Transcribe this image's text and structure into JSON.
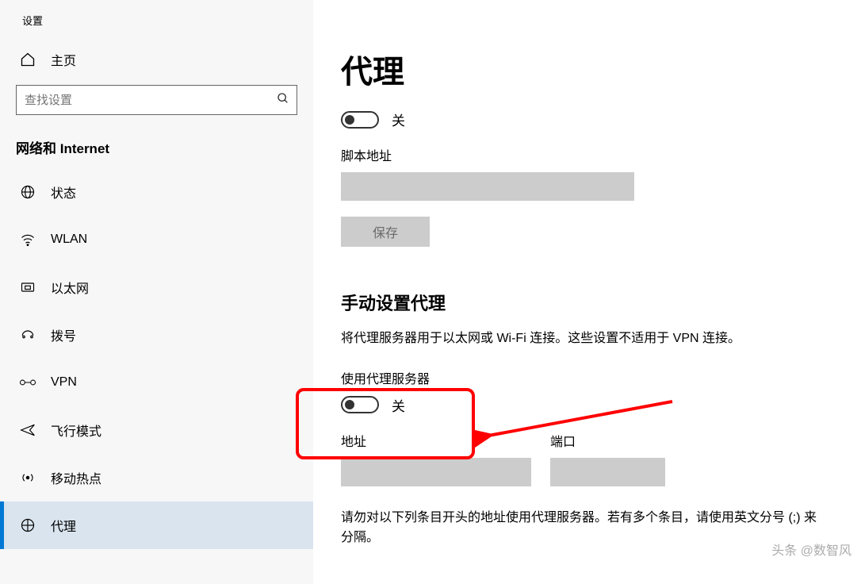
{
  "app": {
    "title": "设置"
  },
  "sidebar": {
    "home_label": "主页",
    "search_placeholder": "查找设置",
    "category": "网络和 Internet",
    "items": [
      {
        "label": "状态"
      },
      {
        "label": "WLAN"
      },
      {
        "label": "以太网"
      },
      {
        "label": "拨号"
      },
      {
        "label": "VPN"
      },
      {
        "label": "飞行模式"
      },
      {
        "label": "移动热点"
      },
      {
        "label": "代理"
      }
    ]
  },
  "main": {
    "page_title": "代理",
    "auto_toggle_state": "关",
    "script_address_label": "脚本地址",
    "script_address_value": "",
    "save_label": "保存",
    "manual_title": "手动设置代理",
    "manual_desc": "将代理服务器用于以太网或 Wi-Fi 连接。这些设置不适用于 VPN 连接。",
    "use_proxy_label": "使用代理服务器",
    "use_proxy_state": "关",
    "address_label": "地址",
    "address_value": "",
    "port_label": "端口",
    "port_value": "",
    "exclude_note": "请勿对以下列条目开头的地址使用代理服务器。若有多个条目，请使用英文分号 (;) 来分隔。"
  },
  "watermark": "头条 @数智风"
}
